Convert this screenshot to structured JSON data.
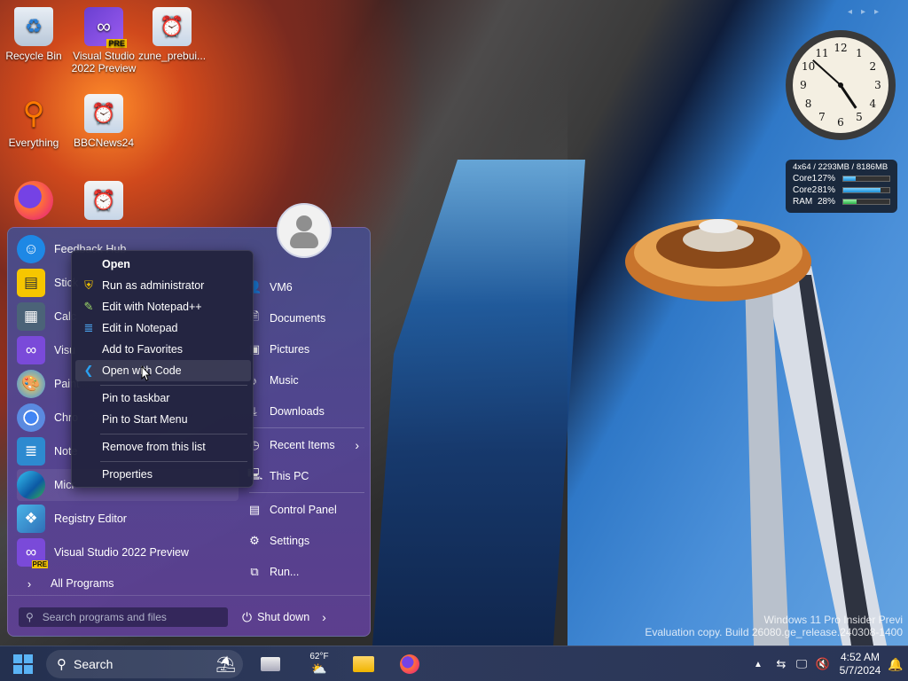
{
  "desktop": {
    "icons": [
      {
        "label": "Recycle Bin",
        "icon": "recycle-bin-icon"
      },
      {
        "label": "Visual Studio 2022 Preview",
        "icon": "visual-studio-icon",
        "badge": "PRE"
      },
      {
        "label": "zune_prebui...",
        "icon": "calculator-clock-icon"
      },
      {
        "label": "Everything",
        "icon": "magnifier-icon"
      },
      {
        "label": "BBCNews24",
        "icon": "calculator-clock-icon"
      },
      {
        "label": "",
        "icon": "firefox-icon"
      },
      {
        "label": "",
        "icon": "calculator-clock-icon"
      }
    ]
  },
  "gadgets": {
    "clock_numbers": [
      "12",
      "1",
      "2",
      "3",
      "4",
      "5",
      "6",
      "7",
      "8",
      "9",
      "10",
      "11"
    ],
    "clock_time": {
      "hour": 4,
      "minute": 52
    },
    "cpu_meter": {
      "header": "4x64 / 2293MB / 8186MB",
      "rows": [
        {
          "label": "Core1",
          "value": "27%",
          "fraction": 0.27
        },
        {
          "label": "Core2",
          "value": "81%",
          "fraction": 0.81
        },
        {
          "label": "RAM",
          "value": "28%",
          "fraction": 0.28
        }
      ]
    }
  },
  "start_menu": {
    "programs": [
      {
        "label": "Feedback Hub",
        "icon": "feedback-hub-icon"
      },
      {
        "label": "Stick",
        "icon": "sticky-notes-icon"
      },
      {
        "label": "Calc",
        "icon": "calculator-icon"
      },
      {
        "label": "Visu",
        "icon": "visual-studio-installer-icon"
      },
      {
        "label": "Paint",
        "icon": "paint-icon"
      },
      {
        "label": "Chro",
        "icon": "chrome-icon"
      },
      {
        "label": "Note",
        "icon": "notepad-icon"
      },
      {
        "label": "Micr",
        "icon": "edge-icon"
      },
      {
        "label": "Registry Editor",
        "icon": "registry-editor-icon"
      },
      {
        "label": "Visual Studio 2022 Preview",
        "icon": "visual-studio-icon",
        "badge": "PRE"
      }
    ],
    "all_programs": "All Programs",
    "search_placeholder": "Search programs and files",
    "right_items": [
      {
        "label": "VM6",
        "icon": "user-folder-icon"
      },
      {
        "label": "Documents",
        "icon": "documents-icon"
      },
      {
        "label": "Pictures",
        "icon": "pictures-icon"
      },
      {
        "label": "Music",
        "icon": "music-icon"
      },
      {
        "label": "Downloads",
        "icon": "downloads-icon"
      },
      {
        "label": "Recent Items",
        "icon": "recent-items-icon"
      },
      {
        "label": "This PC",
        "icon": "this-pc-icon"
      },
      {
        "label": "Control Panel",
        "icon": "control-panel-icon"
      },
      {
        "label": "Settings",
        "icon": "settings-gear-icon"
      },
      {
        "label": "Run...",
        "icon": "run-icon"
      }
    ],
    "shutdown": "Shut down"
  },
  "context_menu": {
    "items": [
      {
        "label": "Open",
        "icon": ""
      },
      {
        "label": "Run as administrator",
        "icon": "shield-icon"
      },
      {
        "label": "Edit with Notepad++",
        "icon": "notepad-plus-icon"
      },
      {
        "label": "Edit in Notepad",
        "icon": "notepad-icon"
      },
      {
        "label": "Add to Favorites",
        "icon": ""
      },
      {
        "label": "Open with Code",
        "icon": "vscode-icon"
      },
      {
        "label": "Pin to taskbar",
        "icon": ""
      },
      {
        "label": "Pin to Start Menu",
        "icon": ""
      },
      {
        "label": "Remove from this list",
        "icon": ""
      },
      {
        "label": "Properties",
        "icon": ""
      }
    ]
  },
  "taskbar": {
    "search_label": "Search",
    "weather_temp": "62°F",
    "time": "4:52 AM",
    "date": "5/7/2024"
  },
  "watermark": {
    "line1": "Windows 11 Pro Insider Previ",
    "line2": "Evaluation copy. Build 26080.ge_release.240308-1400"
  }
}
